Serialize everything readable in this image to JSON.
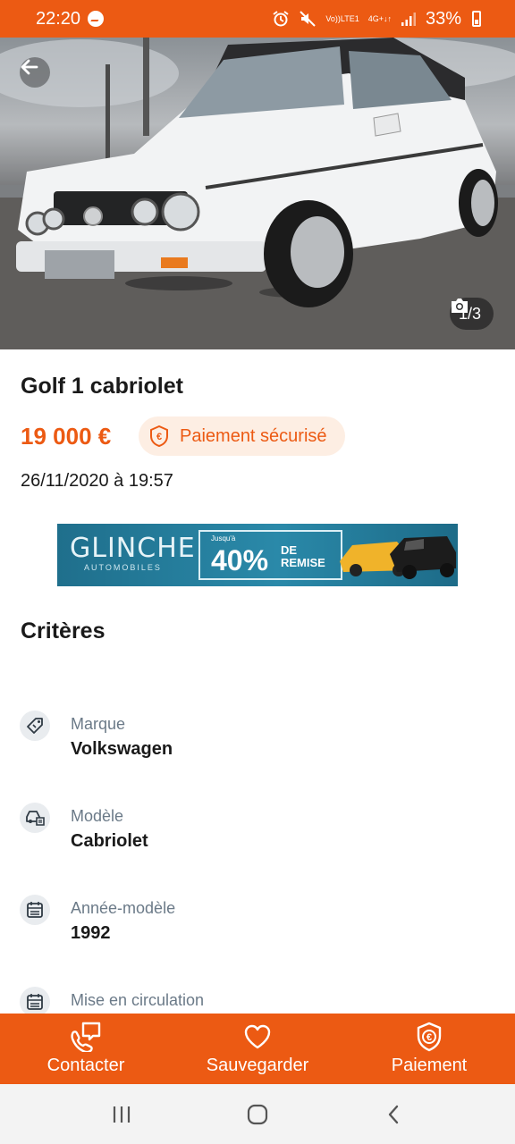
{
  "status_bar": {
    "time": "22:20",
    "network_top": "Vo))",
    "network_bottom": "LTE1",
    "network2_top": "4G+",
    "network2_bottom": "↓↑",
    "battery": "33%"
  },
  "hero": {
    "photo_counter": "1/3"
  },
  "listing": {
    "title": "Golf 1 cabriolet",
    "price": "19 000 €",
    "secure_payment_label": "Paiement sécurisé",
    "date": "26/11/2020 à 19:57"
  },
  "ad": {
    "brand": "GLINCHE",
    "brand_sub": "AUTOMOBILES",
    "promo_small": "Jusqu'à",
    "promo_big": "40%",
    "promo_de": "DE",
    "promo_remise": "REMISE"
  },
  "criteria": {
    "title": "Critères",
    "items": [
      {
        "label": "Marque",
        "value": "Volkswagen",
        "icon": "tag-icon"
      },
      {
        "label": "Modèle",
        "value": "Cabriolet",
        "icon": "car-icon"
      },
      {
        "label": "Année-modèle",
        "value": "1992",
        "icon": "calendar-icon"
      },
      {
        "label": "Mise en circulation",
        "value": "",
        "icon": "calendar-icon"
      }
    ]
  },
  "actions": {
    "contact": "Contacter",
    "save": "Sauvegarder",
    "payment": "Paiement"
  },
  "colors": {
    "accent": "#ec5a13",
    "pill_bg": "#fdeee3",
    "label_gray": "#6b7a88"
  }
}
